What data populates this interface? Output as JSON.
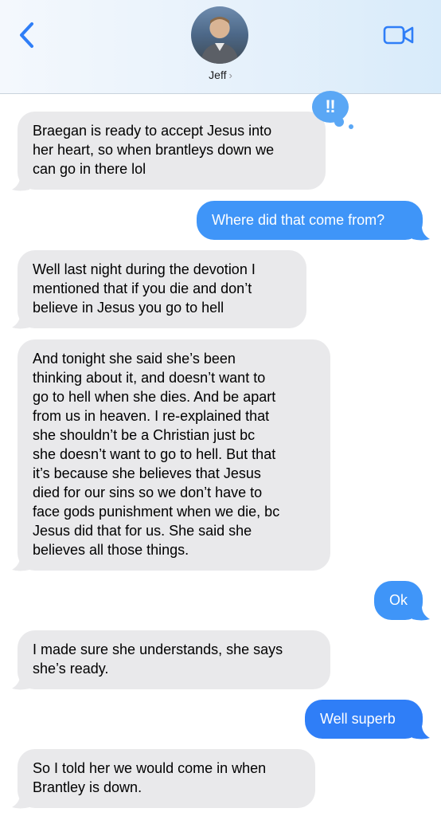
{
  "header": {
    "contact_name": "Jeff",
    "chevron": "›",
    "back_icon": "chevron-left-icon",
    "video_icon": "video-camera-icon",
    "accent_color": "#2f7ef7"
  },
  "reaction": {
    "symbol": "‼"
  },
  "messages": [
    {
      "direction": "incoming",
      "text": "Braegan is ready to accept Jesus into\nher heart, so when brantleys down we\ncan go in there lol"
    },
    {
      "direction": "outgoing",
      "text": "Where did that come from?"
    },
    {
      "direction": "incoming",
      "text": "Well last night during the devotion I\nmentioned that if you die and don’t\nbelieve in Jesus you go to hell"
    },
    {
      "direction": "incoming",
      "text": "And tonight she said she’s been\nthinking about it, and doesn’t want to\ngo to hell when she dies. And be apart\nfrom us in heaven. I re-explained that\nshe shouldn’t be a Christian just bc\nshe doesn’t want to go to hell. But that\nit’s because she believes that Jesus\ndied for our sins so we don’t have to\nface gods punishment when we die, bc\nJesus did that for us. She said she\nbelieves all those things."
    },
    {
      "direction": "outgoing",
      "text": "Ok"
    },
    {
      "direction": "incoming",
      "text": "I made sure she understands, she says\nshe’s ready."
    },
    {
      "direction": "outgoing",
      "text": "Well superb"
    },
    {
      "direction": "incoming",
      "text": "So I told her we would come in when\nBrantley is down."
    }
  ]
}
